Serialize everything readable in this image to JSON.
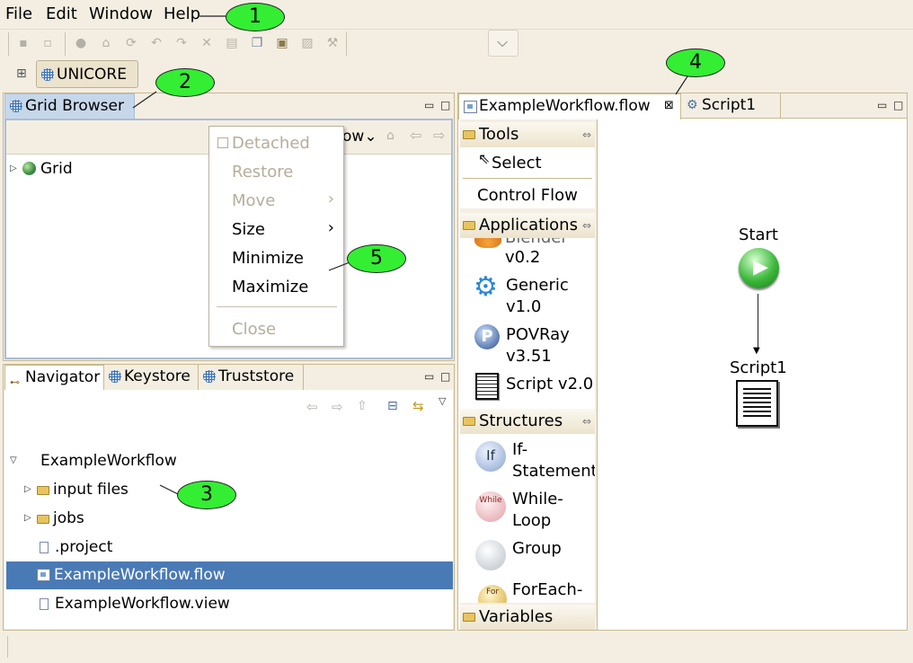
{
  "menu": [
    "File",
    "Edit",
    "Window",
    "Help"
  ],
  "perspective": {
    "label": "UNICORE"
  },
  "grid_browser": {
    "tab": "Grid Browser",
    "view_menu_partial": "ow",
    "tree": [
      {
        "label": "Grid"
      }
    ]
  },
  "context_menu": {
    "items": [
      {
        "label": "Detached",
        "enabled": false,
        "checkbox": true
      },
      {
        "label": "Restore",
        "enabled": false
      },
      {
        "label": "Move",
        "enabled": false,
        "submenu": true
      },
      {
        "label": "Size",
        "enabled": true,
        "submenu": true
      },
      {
        "label": "Minimize",
        "enabled": true
      },
      {
        "label": "Maximize",
        "enabled": true
      },
      {
        "label": "Close",
        "enabled": false
      }
    ]
  },
  "navigator": {
    "tabs": [
      "Navigator",
      "Keystore",
      "Truststore"
    ],
    "tree": [
      {
        "label": "ExampleWorkflow"
      },
      {
        "label": "input files"
      },
      {
        "label": "jobs"
      },
      {
        "label": ".project"
      },
      {
        "label": "ExampleWorkflow.flow",
        "selected": true
      },
      {
        "label": "ExampleWorkflow.view"
      }
    ]
  },
  "editor": {
    "tabs": [
      {
        "label": "ExampleWorkflow.flow",
        "active": true
      },
      {
        "label": "Script1"
      }
    ],
    "palette": {
      "tools": {
        "header": "Tools",
        "items": [
          "Select",
          "Control Flow"
        ]
      },
      "applications": {
        "header": "Applications",
        "items": [
          {
            "name": "Blender",
            "version": "v0.2"
          },
          {
            "name": "Generic",
            "version": "v1.0"
          },
          {
            "name": "POVRay",
            "version": "v3.51"
          },
          {
            "name": "Script v2.0"
          }
        ]
      },
      "structures": {
        "header": "Structures",
        "items": [
          {
            "line1": "If-",
            "line2": "Statement",
            "icon_text": "If"
          },
          {
            "line1": "While-",
            "line2": "Loop",
            "icon_text": "While"
          },
          {
            "line1": "Group"
          },
          {
            "line1": "ForEach-",
            "icon_text": "For"
          }
        ]
      },
      "variables": {
        "header": "Variables"
      }
    },
    "canvas": {
      "start_label": "Start",
      "script_label": "Script1"
    }
  },
  "callouts": [
    "1",
    "2",
    "3",
    "4",
    "5"
  ],
  "colors": {
    "background": "#f4eee2",
    "selection": "#4a7ab5",
    "callout": "#33ee33",
    "active_tab": "#c7d7ea"
  }
}
